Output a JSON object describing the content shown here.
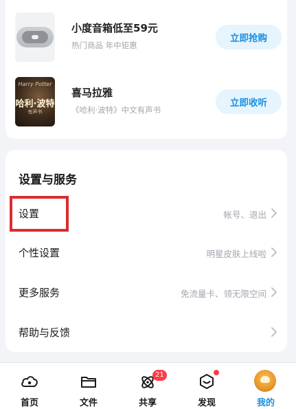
{
  "promo": {
    "items": [
      {
        "title": "小度音箱低至59元",
        "subtitle": "热门商品  年中钜惠",
        "button": "立即抢购",
        "thumb": "speaker-image"
      },
      {
        "title": "喜马拉雅",
        "subtitle": "《哈利·波特》中文有声书",
        "button": "立即收听",
        "thumb": "harry-potter-cover",
        "cover_text": [
          "Harry Potter",
          "哈利·波特",
          "有声书"
        ]
      }
    ]
  },
  "settings": {
    "title": "设置与服务",
    "rows": [
      {
        "label": "设置",
        "value": "帐号、退出",
        "highlighted": true
      },
      {
        "label": "个性设置",
        "value": "明星皮肤上线啦"
      },
      {
        "label": "更多服务",
        "value": "免流量卡、领无限空间"
      },
      {
        "label": "帮助与反馈",
        "value": ""
      }
    ]
  },
  "tabbar": {
    "tabs": [
      {
        "label": "首页",
        "icon": "cloud-icon"
      },
      {
        "label": "文件",
        "icon": "folder-icon"
      },
      {
        "label": "共享",
        "icon": "share-icon",
        "badge": "21"
      },
      {
        "label": "发现",
        "icon": "discover-icon",
        "dot": true
      },
      {
        "label": "我的",
        "icon": "avatar",
        "active": true
      }
    ]
  },
  "colors": {
    "accent": "#1a8fe3",
    "button_bg": "#e5f4fd",
    "badge": "#ff3b47",
    "highlight": "#d92d2d",
    "page_bg": "#f3f4f8"
  }
}
